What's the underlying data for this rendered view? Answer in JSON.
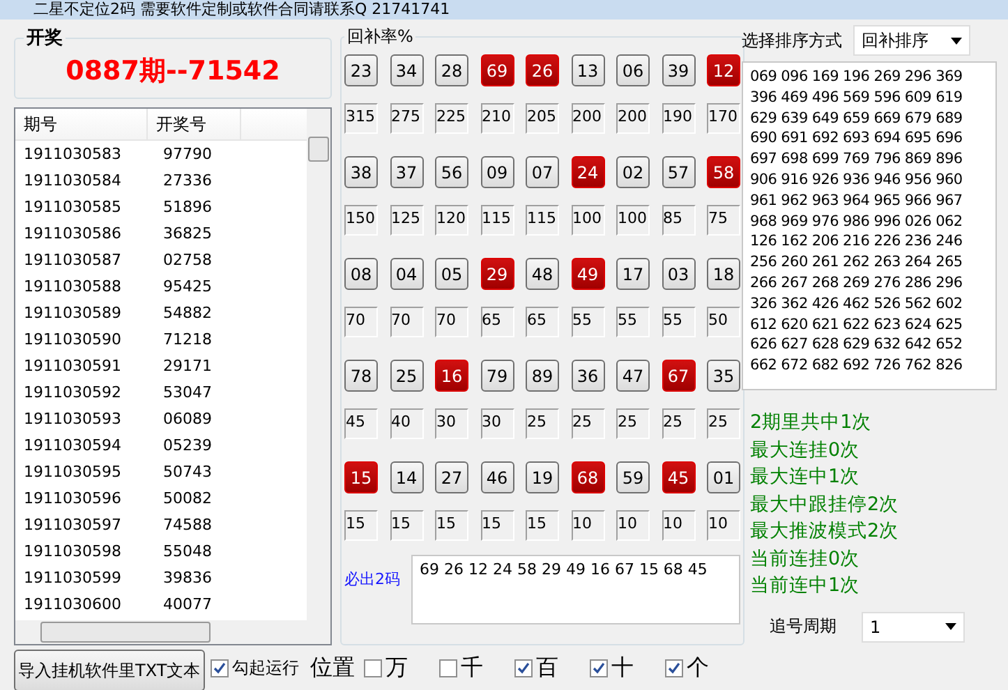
{
  "window": {
    "title": "二星不定位2码 需要软件定制或软件合同请联系Q 21741741"
  },
  "draw": {
    "label": "开奖",
    "result": "0887期--71542"
  },
  "history": {
    "columns": [
      "期号",
      "开奖号"
    ],
    "rows": [
      [
        "1911030583",
        "97790"
      ],
      [
        "1911030584",
        "27336"
      ],
      [
        "1911030585",
        "51896"
      ],
      [
        "1911030586",
        "36825"
      ],
      [
        "1911030587",
        "02758"
      ],
      [
        "1911030588",
        "95425"
      ],
      [
        "1911030589",
        "54882"
      ],
      [
        "1911030590",
        "71218"
      ],
      [
        "1911030591",
        "29171"
      ],
      [
        "1911030592",
        "53047"
      ],
      [
        "1911030593",
        "06089"
      ],
      [
        "1911030594",
        "05239"
      ],
      [
        "1911030595",
        "50743"
      ],
      [
        "1911030596",
        "50082"
      ],
      [
        "1911030597",
        "74588"
      ],
      [
        "1911030598",
        "55048"
      ],
      [
        "1911030599",
        "39836"
      ],
      [
        "1911030600",
        "40077"
      ]
    ]
  },
  "rebound": {
    "label": "回补率%",
    "rows": [
      [
        {
          "number": "23",
          "highlighted": false,
          "value": "315"
        },
        {
          "number": "34",
          "highlighted": false,
          "value": "275"
        },
        {
          "number": "28",
          "highlighted": false,
          "value": "225"
        },
        {
          "number": "69",
          "highlighted": true,
          "value": "210"
        },
        {
          "number": "26",
          "highlighted": true,
          "value": "205"
        },
        {
          "number": "13",
          "highlighted": false,
          "value": "200"
        },
        {
          "number": "06",
          "highlighted": false,
          "value": "200"
        },
        {
          "number": "39",
          "highlighted": false,
          "value": "190"
        },
        {
          "number": "12",
          "highlighted": true,
          "value": "170"
        }
      ],
      [
        {
          "number": "38",
          "highlighted": false,
          "value": "150"
        },
        {
          "number": "37",
          "highlighted": false,
          "value": "125"
        },
        {
          "number": "56",
          "highlighted": false,
          "value": "120"
        },
        {
          "number": "09",
          "highlighted": false,
          "value": "115"
        },
        {
          "number": "07",
          "highlighted": false,
          "value": "115"
        },
        {
          "number": "24",
          "highlighted": true,
          "value": "100"
        },
        {
          "number": "02",
          "highlighted": false,
          "value": "100"
        },
        {
          "number": "57",
          "highlighted": false,
          "value": "85"
        },
        {
          "number": "58",
          "highlighted": true,
          "value": "75"
        }
      ],
      [
        {
          "number": "08",
          "highlighted": false,
          "value": "70"
        },
        {
          "number": "04",
          "highlighted": false,
          "value": "70"
        },
        {
          "number": "05",
          "highlighted": false,
          "value": "70"
        },
        {
          "number": "29",
          "highlighted": true,
          "value": "65"
        },
        {
          "number": "48",
          "highlighted": false,
          "value": "65"
        },
        {
          "number": "49",
          "highlighted": true,
          "value": "55"
        },
        {
          "number": "17",
          "highlighted": false,
          "value": "55"
        },
        {
          "number": "03",
          "highlighted": false,
          "value": "55"
        },
        {
          "number": "18",
          "highlighted": false,
          "value": "50"
        }
      ],
      [
        {
          "number": "78",
          "highlighted": false,
          "value": "45"
        },
        {
          "number": "25",
          "highlighted": false,
          "value": "40"
        },
        {
          "number": "16",
          "highlighted": true,
          "value": "30"
        },
        {
          "number": "79",
          "highlighted": false,
          "value": "30"
        },
        {
          "number": "89",
          "highlighted": false,
          "value": "25"
        },
        {
          "number": "36",
          "highlighted": false,
          "value": "25"
        },
        {
          "number": "47",
          "highlighted": false,
          "value": "25"
        },
        {
          "number": "67",
          "highlighted": true,
          "value": "25"
        },
        {
          "number": "35",
          "highlighted": false,
          "value": "25"
        }
      ],
      [
        {
          "number": "15",
          "highlighted": true,
          "value": "15"
        },
        {
          "number": "14",
          "highlighted": false,
          "value": "15"
        },
        {
          "number": "27",
          "highlighted": false,
          "value": "15"
        },
        {
          "number": "46",
          "highlighted": false,
          "value": "15"
        },
        {
          "number": "19",
          "highlighted": false,
          "value": "15"
        },
        {
          "number": "68",
          "highlighted": true,
          "value": "10"
        },
        {
          "number": "59",
          "highlighted": false,
          "value": "10"
        },
        {
          "number": "45",
          "highlighted": true,
          "value": "10"
        },
        {
          "number": "01",
          "highlighted": false,
          "value": "10"
        }
      ]
    ]
  },
  "must_out": {
    "label": "必出2码",
    "value": "69 26 12 24 58 29 49 16 67 15 68 45"
  },
  "sort": {
    "label": "选择排序方式",
    "value": "回补排序"
  },
  "combos": {
    "lines": [
      "069 096 169 196 269 296 369",
      "396 469 496 569 596 609 619",
      "629 639 649 659 669 679 689",
      "690 691 692 693 694 695 696",
      "697 698 699 769 796 869 896",
      "906 916 926 936 946 956 960",
      "961 962 963 964 965 966 967",
      "968 969 976 986 996 026 062",
      "126 162 206 216 226 236 246",
      "256 260 261 262 263 264 265",
      "266 267 268 269 276 286 296",
      "326 362 426 462 526 562 602",
      "612 620 621 622 623 624 625",
      "626 627 628 629 632 642 652",
      "662 672 682 692 726 762 826"
    ]
  },
  "stats": [
    "2期里共中1次",
    "最大连挂0次",
    "最大连中1次",
    "最大中跟挂停2次",
    "最大推波模式2次",
    "当前连挂0次",
    "当前连中1次"
  ],
  "cycle": {
    "label": "追号周期",
    "value": "1"
  },
  "bottom": {
    "import_button": "导入挂机软件里TXT文本",
    "autorun": {
      "label": "勾起运行",
      "checked": true
    },
    "position_label": "位置",
    "positions": [
      {
        "label": "万",
        "checked": false
      },
      {
        "label": "千",
        "checked": false
      },
      {
        "label": "百",
        "checked": true
      },
      {
        "label": "十",
        "checked": true
      },
      {
        "label": "个",
        "checked": true
      }
    ]
  }
}
